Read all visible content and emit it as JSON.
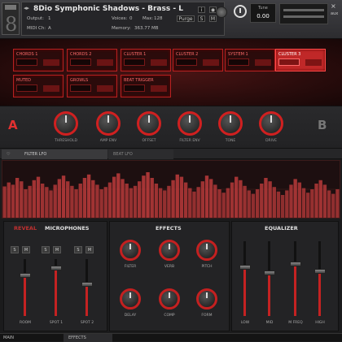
{
  "header": {
    "title": "8Dio Symphonic Shadows - Brass - L",
    "output_label": "Output:",
    "output_value": "1",
    "midi_label": "MIDI Ch:",
    "midi_value": "A",
    "voices_label": "Voices:",
    "voices_value": "0",
    "max_label": "Max:",
    "max_value": "128",
    "memory_label": "Memory:",
    "memory_value": "363.77 MB",
    "purge_label": "Purge",
    "tune_label": "Tune",
    "tune_value": "0.00",
    "aux_label": "aux",
    "close": "×"
  },
  "articulations": [
    {
      "label": "CHORDS 1"
    },
    {
      "label": "CHORDS 2"
    },
    {
      "label": "CLUSTER 1"
    },
    {
      "label": "CLUSTER 2"
    },
    {
      "label": "SYSTEM 1"
    },
    {
      "label": "CLUSTER 3",
      "active": true
    },
    {
      "label": "MUTED"
    },
    {
      "label": "GROWLS"
    },
    {
      "label": "BEAT TRIGGER"
    }
  ],
  "slots": {
    "a": "A",
    "b": "B"
  },
  "knobs": [
    {
      "label": "THRESHOLD"
    },
    {
      "label": "AMP ENV"
    },
    {
      "label": "OFFSET"
    },
    {
      "label": "FILTER ENV"
    },
    {
      "label": "TONE"
    },
    {
      "label": "DRIVE"
    }
  ],
  "lfo": {
    "tab_active": "FILTER LFO",
    "tab_inactive": "BEAT LFO",
    "bars": [
      0.55,
      0.62,
      0.58,
      0.7,
      0.64,
      0.5,
      0.56,
      0.66,
      0.72,
      0.6,
      0.54,
      0.48,
      0.58,
      0.68,
      0.74,
      0.64,
      0.56,
      0.5,
      0.6,
      0.7,
      0.76,
      0.66,
      0.58,
      0.5,
      0.54,
      0.62,
      0.72,
      0.78,
      0.68,
      0.6,
      0.52,
      0.56,
      0.64,
      0.74,
      0.8,
      0.7,
      0.6,
      0.52,
      0.48,
      0.56,
      0.66,
      0.76,
      0.72,
      0.62,
      0.52,
      0.46,
      0.54,
      0.64,
      0.74,
      0.68,
      0.58,
      0.5,
      0.44,
      0.52,
      0.62,
      0.72,
      0.66,
      0.56,
      0.48,
      0.42,
      0.5,
      0.6,
      0.7,
      0.64,
      0.54,
      0.46,
      0.4,
      0.48,
      0.58,
      0.68,
      0.62,
      0.52,
      0.44,
      0.5,
      0.6,
      0.66,
      0.58,
      0.48,
      0.42,
      0.5
    ]
  },
  "mics": {
    "title": "MICROPHONES",
    "subtitle": "REVEAL",
    "letters": [
      "S",
      "M",
      "S",
      "M",
      "S",
      "M"
    ],
    "faders": [
      {
        "label": "ROOM",
        "value": 0.72
      },
      {
        "label": "SPOT 1",
        "value": 0.84
      },
      {
        "label": "SPOT 2",
        "value": 0.55
      }
    ]
  },
  "effects": {
    "title": "EFFECTS",
    "knobs": [
      {
        "label": "FILTER"
      },
      {
        "label": "VERB"
      },
      {
        "label": "PITCH"
      },
      {
        "label": "DELAY"
      },
      {
        "label": "COMP"
      },
      {
        "label": "FORM"
      }
    ]
  },
  "eq": {
    "title": "EQUALIZER",
    "faders": [
      {
        "label": "LOW",
        "value": 0.65
      },
      {
        "label": "MID",
        "value": 0.58
      },
      {
        "label": "M FREQ",
        "value": 0.7
      },
      {
        "label": "HIGH",
        "value": 0.6
      }
    ]
  },
  "status": {
    "left": "MAIN",
    "tab": "EFFECTS"
  },
  "colors": {
    "accent": "#c42222",
    "active_artic": "#c02828",
    "lfo_bar": "#b83a3a"
  }
}
